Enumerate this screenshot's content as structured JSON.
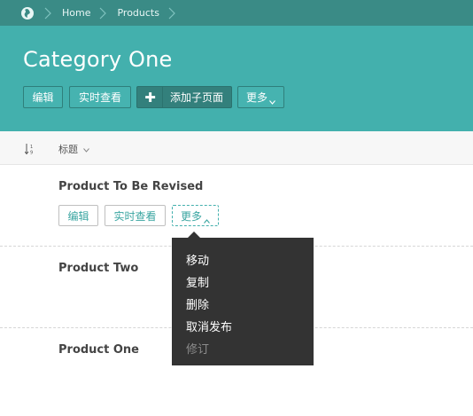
{
  "breadcrumb": {
    "items": [
      "Home",
      "Products"
    ]
  },
  "header": {
    "title": "Category One",
    "buttons": {
      "edit": "编辑",
      "live_view": "实时查看",
      "add_child": "添加子页面",
      "more": "更多"
    }
  },
  "columns": {
    "title": "标题"
  },
  "rows": [
    {
      "title": "Product To Be Revised",
      "actions": {
        "edit": "编辑",
        "live_view": "实时查看",
        "more": "更多"
      }
    },
    {
      "title": "Product Two"
    },
    {
      "title": "Product One"
    }
  ],
  "dropdown": {
    "items": [
      "移动",
      "复制",
      "删除",
      "取消发布",
      "修订"
    ]
  },
  "colors": {
    "header_bg": "#43b0ad",
    "breadcrumb_bg": "#3a8b86",
    "menu_bg": "#333333",
    "accent": "#3aa5a1"
  }
}
